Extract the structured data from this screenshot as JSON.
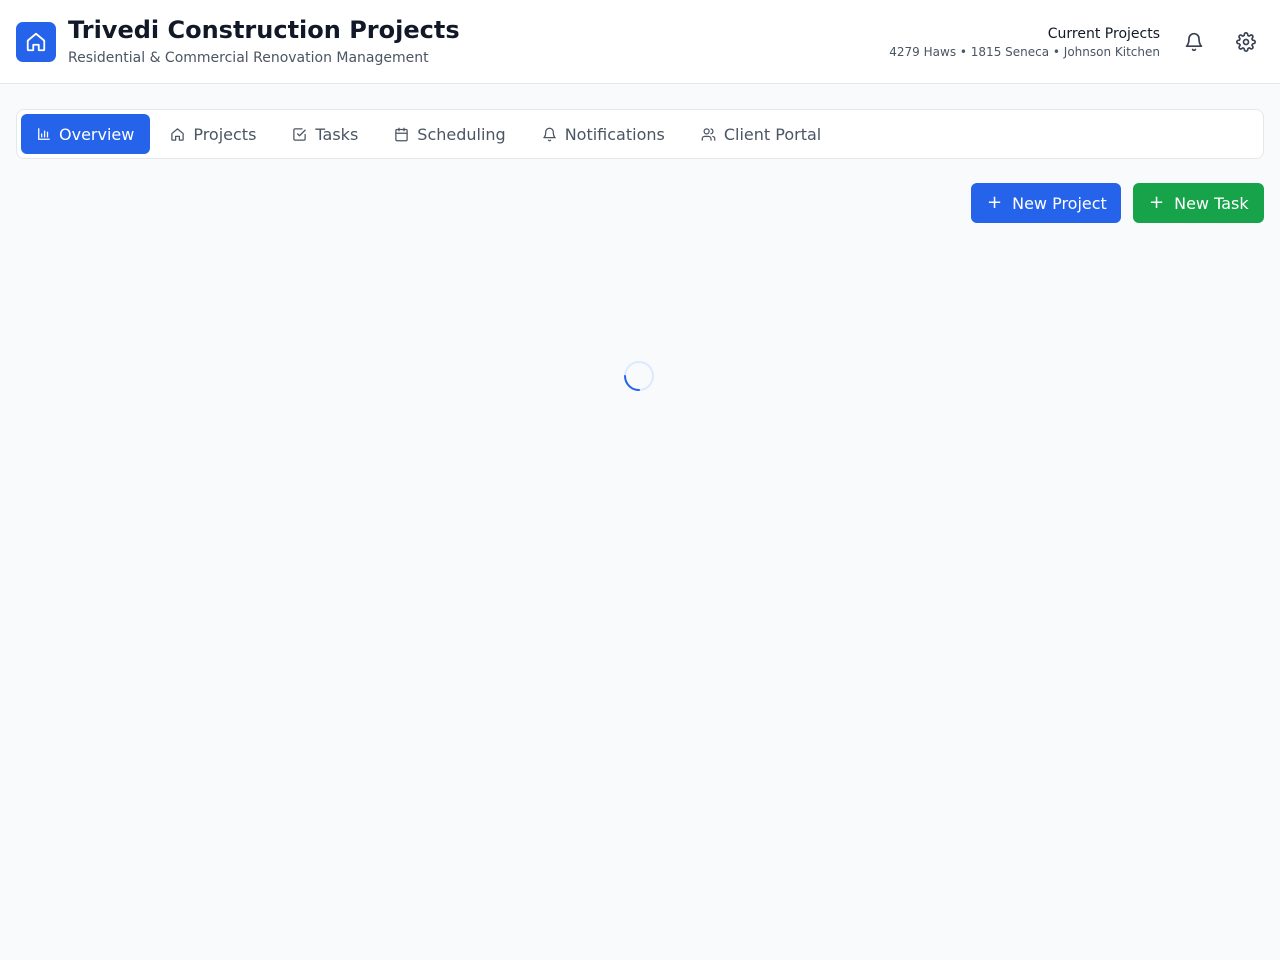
{
  "header": {
    "title": "Trivedi Construction Projects",
    "subtitle": "Residential & Commercial Renovation Management",
    "current_projects_label": "Current Projects",
    "current_projects_list": "4279 Haws • 1815 Seneca • Johnson Kitchen",
    "icons": [
      "home-icon",
      "bell-icon",
      "gear-icon"
    ]
  },
  "tabs": [
    {
      "label": "Overview",
      "icon": "bar-chart-icon",
      "active": true
    },
    {
      "label": "Projects",
      "icon": "home-icon",
      "active": false
    },
    {
      "label": "Tasks",
      "icon": "checkbox-icon",
      "active": false
    },
    {
      "label": "Scheduling",
      "icon": "calendar-icon",
      "active": false
    },
    {
      "label": "Notifications",
      "icon": "bell-icon",
      "active": false
    },
    {
      "label": "Client Portal",
      "icon": "users-icon",
      "active": false
    }
  ],
  "actions": {
    "new_project_label": "New Project",
    "new_task_label": "New Task",
    "plus_glyph": "+"
  },
  "colors": {
    "primary": "#2563eb",
    "success": "#16a34a",
    "background": "#f8fafc",
    "text": "#111827",
    "muted": "#4b5563"
  }
}
